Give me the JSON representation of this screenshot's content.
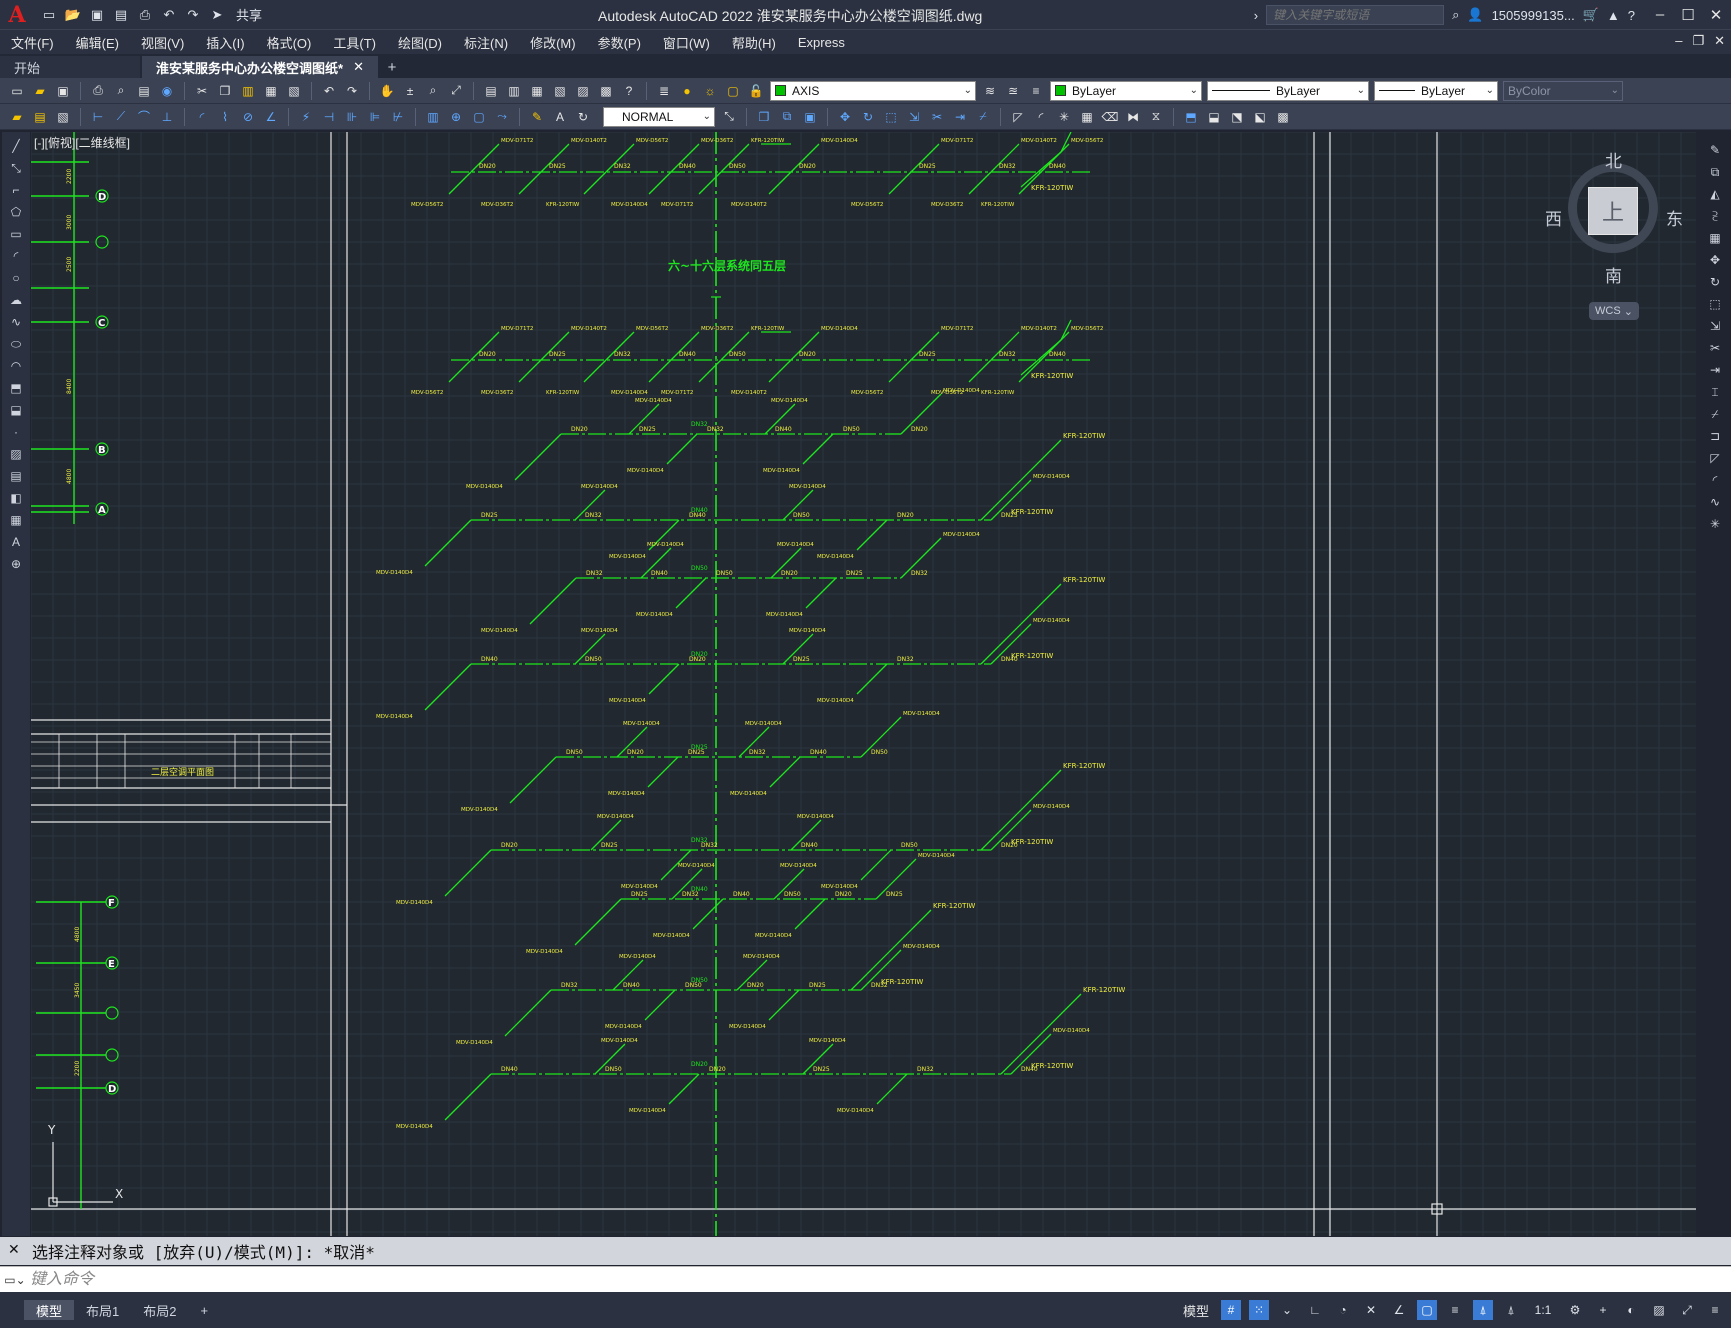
{
  "app": {
    "logo": "A",
    "title": "Autodesk AutoCAD 2022    淮安某服务中心办公楼空调图纸.dwg",
    "share_label": "共享",
    "search_placeholder": "键入关键字或短语",
    "user": "1505999135..."
  },
  "menu": [
    "文件(F)",
    "编辑(E)",
    "视图(V)",
    "插入(I)",
    "格式(O)",
    "工具(T)",
    "绘图(D)",
    "标注(N)",
    "修改(M)",
    "参数(P)",
    "窗口(W)",
    "帮助(H)",
    "Express"
  ],
  "tabs": [
    {
      "label": "开始"
    },
    {
      "label": "淮安某服务中心办公楼空调图纸*"
    }
  ],
  "toolbar": {
    "layer": "AXIS",
    "layer_color": "#00c000",
    "color": "ByLayer",
    "linetype": "ByLayer",
    "lineweight": "ByLayer",
    "plotstyle": "ByColor",
    "dimstyle": "NORMAL"
  },
  "viewport_label": "[-][俯视][二维线框]",
  "viewcube": {
    "north": "北",
    "south": "南",
    "west": "西",
    "east": "东",
    "face": "上",
    "wcs": "WCS"
  },
  "drawing": {
    "section_title": "六~十六层系统同五层",
    "axis_bubbles_top": [
      "D",
      "C",
      "B",
      "A"
    ],
    "axis_bubbles_bottom": [
      "F",
      "E",
      "D"
    ],
    "dims_top": [
      "2200",
      "3000",
      "2500",
      "8400",
      "4800"
    ],
    "dims_bottom": [
      "4800",
      "3450",
      "2200"
    ],
    "pipe_labels": [
      "DN20",
      "DN25",
      "DN32",
      "DN40",
      "DN50"
    ],
    "unit_labels": [
      "MDV-D71T2",
      "MDV-D140T2",
      "MDV-D56T2",
      "MDV-D36T2",
      "KFR-120TIW",
      "MDV-D140D4"
    ],
    "title_block": "二层空调平面图",
    "colors": {
      "pipe": "#1ee61e",
      "text": "#f0f040",
      "frame": "#e6e6e6",
      "bg": "#212830"
    }
  },
  "command": {
    "history": "选择注释对象或 [放弃(U)/模式(M)]: *取消*",
    "placeholder": "键入命令"
  },
  "layouts": [
    "模型",
    "布局1",
    "布局2"
  ],
  "status": {
    "model": "模型",
    "scale": "1:1"
  }
}
